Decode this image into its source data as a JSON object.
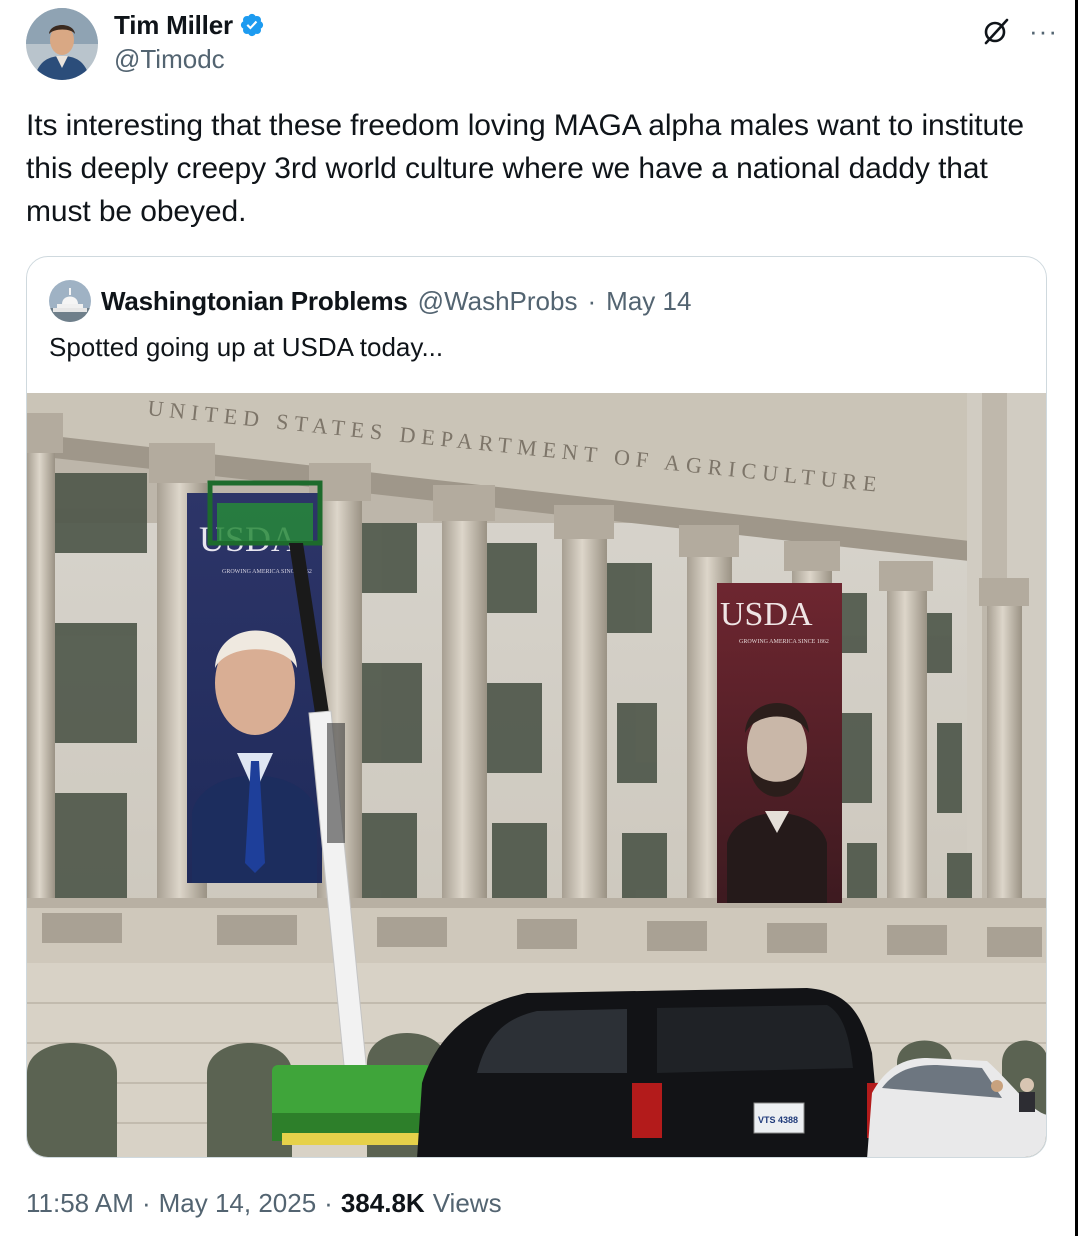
{
  "tweet": {
    "author": {
      "display_name": "Tim Miller",
      "handle": "@Timodc",
      "verified": true,
      "avatar_icon": "user-avatar"
    },
    "text": "Its interesting that these freedom loving MAGA alpha males want to institute this deeply creepy 3rd world culture where we have a national daddy that must be obeyed.",
    "actions": {
      "grok_icon": "grok-icon",
      "more_label": "···"
    },
    "timestamp_time": "11:58 AM",
    "timestamp_date": "May 14, 2025",
    "separator": "·",
    "views_count": "384.8K",
    "views_label": "Views"
  },
  "quote": {
    "author": {
      "display_name": "Washingtonian Problems",
      "handle": "@WashProbs",
      "date": "May 14",
      "separator": "·",
      "avatar_icon": "capitol-avatar"
    },
    "text": "Spotted going up at USDA today...",
    "image": {
      "description_icon": "usda-building-photo",
      "building_inscription": "UNITED STATES DEPARTMENT OF AGRICULTURE",
      "left_banner_text": "USDA",
      "left_banner_sub": "GROWING AMERICA SINCE 1862",
      "right_banner_text": "USDA",
      "right_banner_sub": "GROWING AMERICA SINCE 1862",
      "plate_text": "VTS 4388"
    }
  },
  "colors": {
    "text_primary": "#0f1419",
    "text_secondary": "#536471",
    "verified_blue": "#1d9bf0",
    "border": "#cfd9de"
  }
}
